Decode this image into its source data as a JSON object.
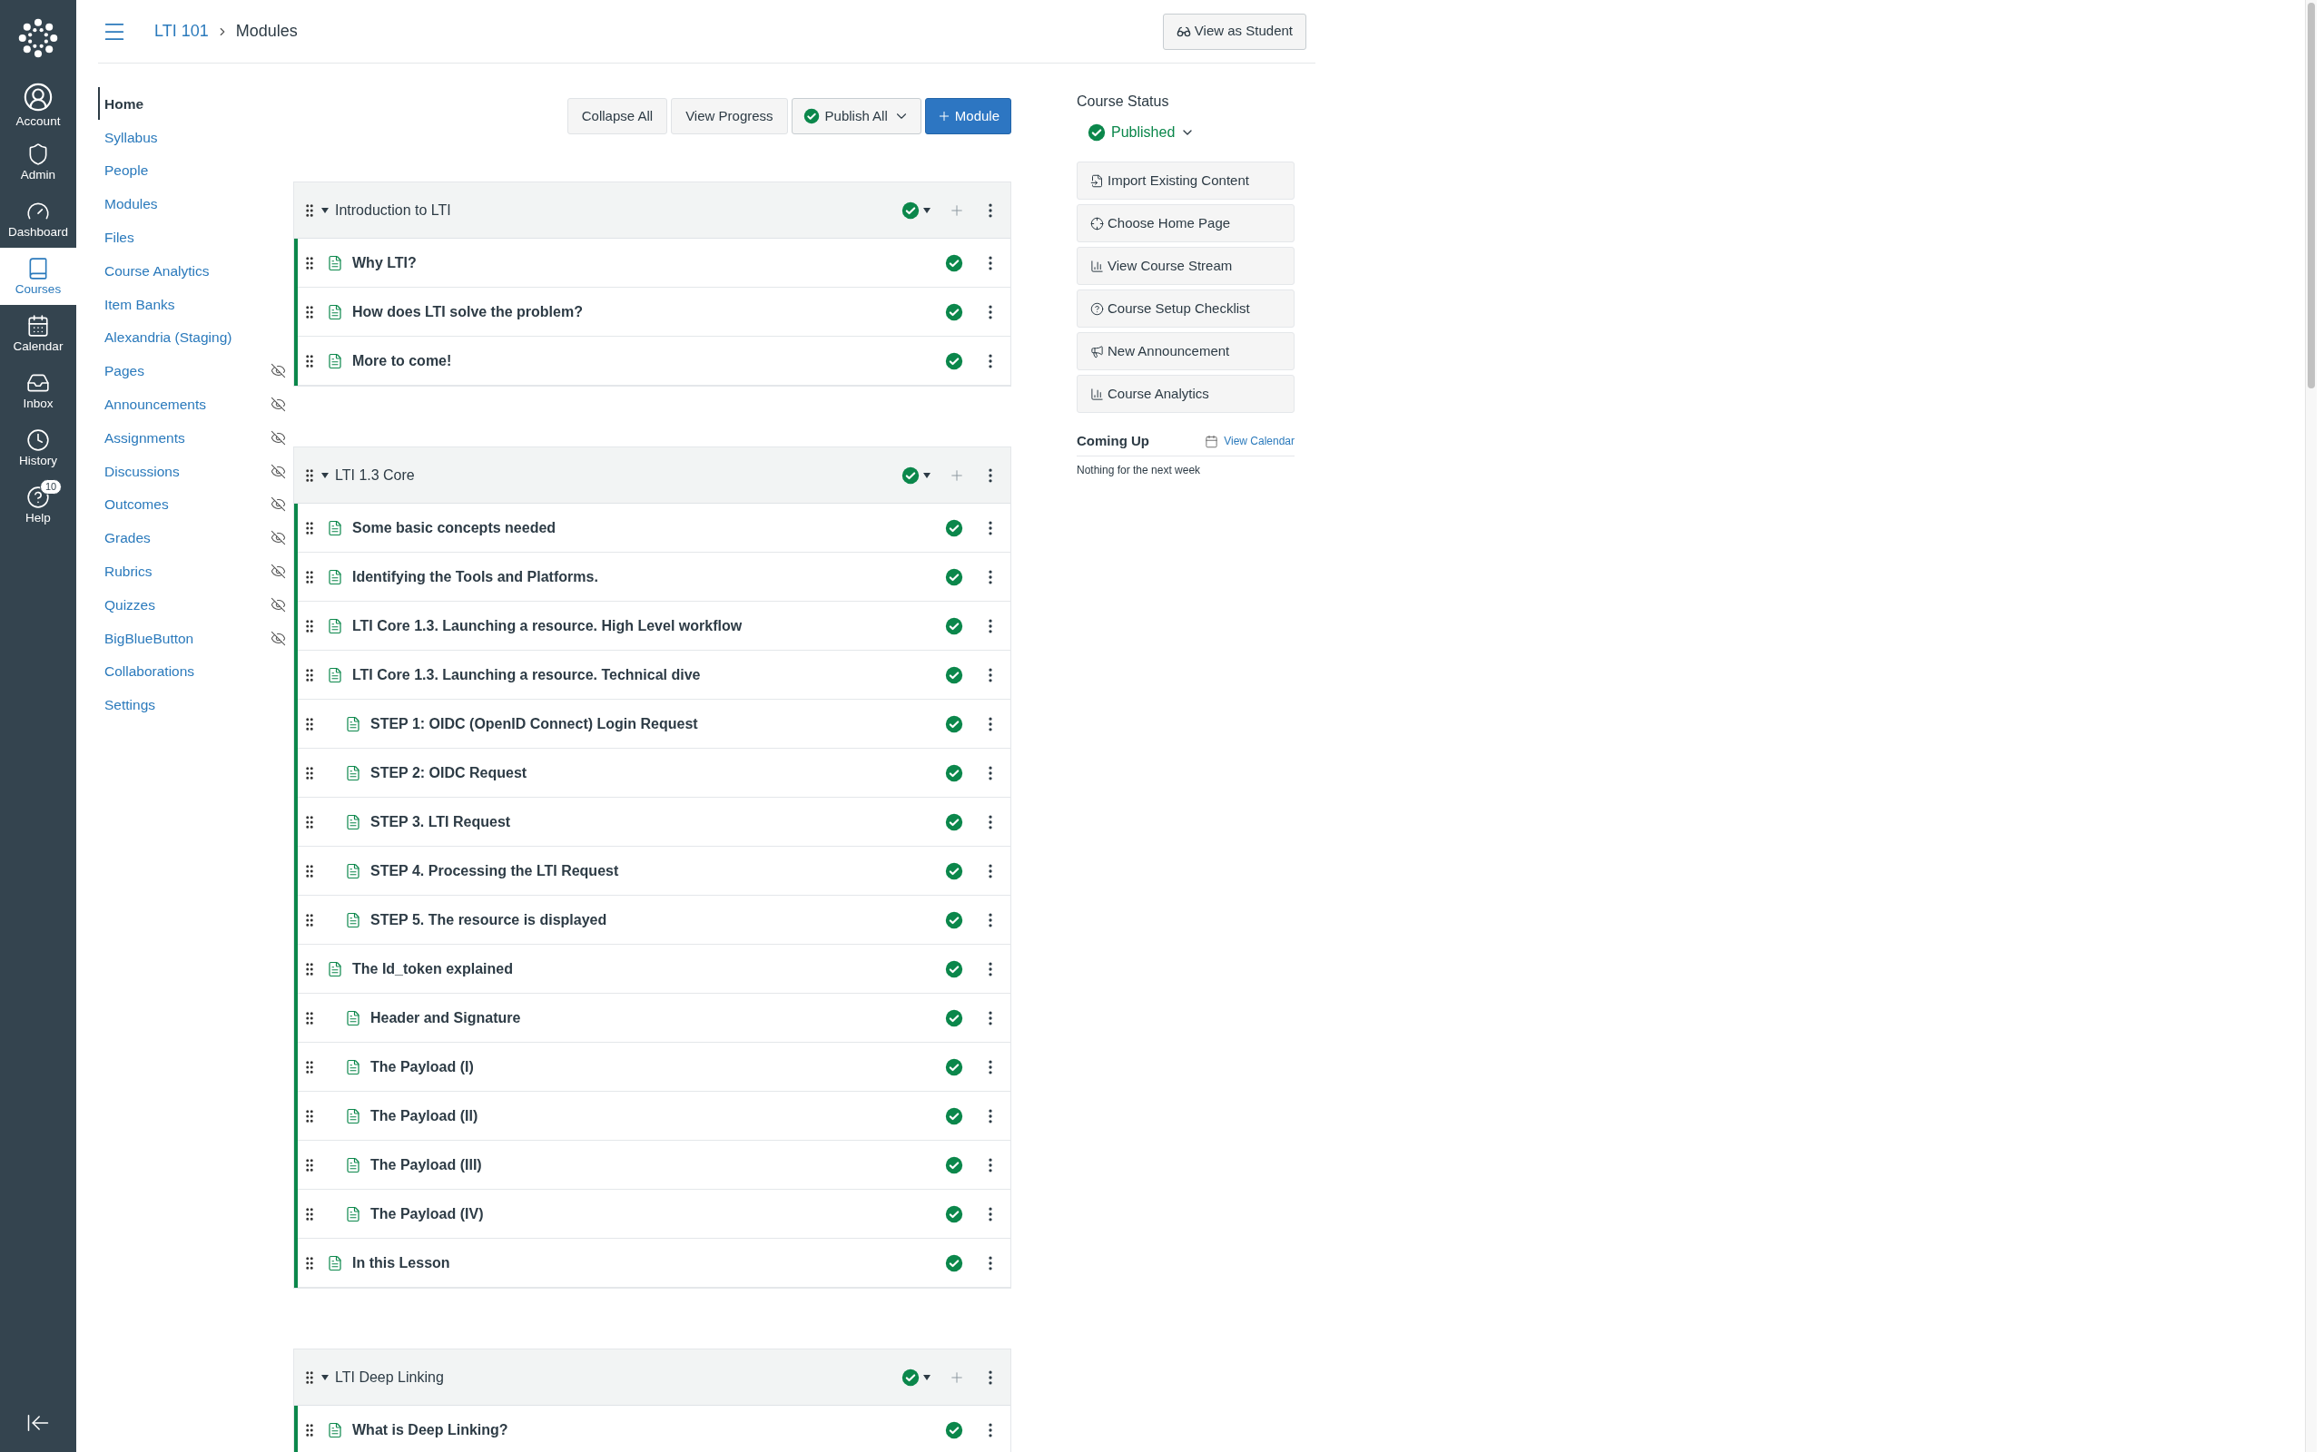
{
  "global_nav": {
    "items": [
      {
        "label": "Account",
        "selected": false
      },
      {
        "label": "Admin",
        "selected": false
      },
      {
        "label": "Dashboard",
        "selected": false
      },
      {
        "label": "Courses",
        "selected": true
      },
      {
        "label": "Calendar",
        "selected": false
      },
      {
        "label": "Inbox",
        "selected": false
      },
      {
        "label": "History",
        "selected": false
      },
      {
        "label": "Help",
        "selected": false,
        "badge": "10"
      }
    ]
  },
  "header": {
    "breadcrumb": [
      "LTI 101",
      "Modules"
    ],
    "view_as_student": "View as Student"
  },
  "course_nav": [
    {
      "label": "Home",
      "selected": true,
      "hidden": false
    },
    {
      "label": "Syllabus",
      "selected": false,
      "hidden": false
    },
    {
      "label": "People",
      "selected": false,
      "hidden": false
    },
    {
      "label": "Modules",
      "selected": false,
      "hidden": false
    },
    {
      "label": "Files",
      "selected": false,
      "hidden": false
    },
    {
      "label": "Course Analytics",
      "selected": false,
      "hidden": false
    },
    {
      "label": "Item Banks",
      "selected": false,
      "hidden": false
    },
    {
      "label": "Alexandria (Staging)",
      "selected": false,
      "hidden": false
    },
    {
      "label": "Pages",
      "selected": false,
      "hidden": true
    },
    {
      "label": "Announcements",
      "selected": false,
      "hidden": true
    },
    {
      "label": "Assignments",
      "selected": false,
      "hidden": true
    },
    {
      "label": "Discussions",
      "selected": false,
      "hidden": true
    },
    {
      "label": "Outcomes",
      "selected": false,
      "hidden": true
    },
    {
      "label": "Grades",
      "selected": false,
      "hidden": true
    },
    {
      "label": "Rubrics",
      "selected": false,
      "hidden": true
    },
    {
      "label": "Quizzes",
      "selected": false,
      "hidden": true
    },
    {
      "label": "BigBlueButton",
      "selected": false,
      "hidden": true
    },
    {
      "label": "Collaborations",
      "selected": false,
      "hidden": false
    },
    {
      "label": "Settings",
      "selected": false,
      "hidden": false
    }
  ],
  "toolbar": {
    "buttons": [
      "Collapse All",
      "View Progress"
    ],
    "publish_all": "Publish All",
    "add_module": "Module"
  },
  "modules": [
    {
      "title": "Introduction to LTI",
      "published": true,
      "items": [
        {
          "title": "Why LTI?",
          "published": true
        },
        {
          "title": "How does LTI solve the problem?",
          "published": true
        },
        {
          "title": "More to come!",
          "published": true
        }
      ]
    },
    {
      "title": "LTI 1.3 Core",
      "published": true,
      "items": [
        {
          "title": "Some basic concepts needed",
          "published": true
        },
        {
          "title": "Identifying the Tools and Platforms.",
          "published": true
        },
        {
          "title": "LTI Core 1.3. Launching a resource. High Level workflow",
          "published": true
        },
        {
          "title": "LTI Core 1.3. Launching a resource. Technical dive",
          "published": true,
          "children": [
            {
              "title": "STEP 1: OIDC (OpenID Connect) Login Request",
              "published": true
            },
            {
              "title": "STEP 2: OIDC Request",
              "published": true
            },
            {
              "title": "STEP 3. LTI Request",
              "published": true
            },
            {
              "title": "STEP 4. Processing the LTI Request",
              "published": true
            },
            {
              "title": "STEP 5. The resource is displayed",
              "published": true
            }
          ]
        },
        {
          "title": "The Id_token explained",
          "published": true,
          "children": [
            {
              "title": "Header and Signature",
              "published": true
            },
            {
              "title": "The Payload (I)",
              "published": true
            },
            {
              "title": "The Payload (II)",
              "published": true
            },
            {
              "title": "The Payload (III)",
              "published": true
            },
            {
              "title": "The Payload (IV)",
              "published": true
            }
          ]
        },
        {
          "title": "In this Lesson",
          "published": true
        }
      ]
    },
    {
      "title": "LTI Deep Linking",
      "published": true,
      "items": [
        {
          "title": "What is Deep Linking?",
          "published": true
        }
      ]
    }
  ],
  "sidebar": {
    "course_status": {
      "title": "Course Status",
      "status": "Published",
      "published": true
    },
    "buttons": [
      "Import Existing Content",
      "Choose Home Page",
      "View Course Stream",
      "Course Setup Checklist",
      "New Announcement",
      "Course Analytics"
    ],
    "coming_up": {
      "title": "Coming Up",
      "link": "View Calendar",
      "empty": "Nothing for the next week"
    }
  }
}
